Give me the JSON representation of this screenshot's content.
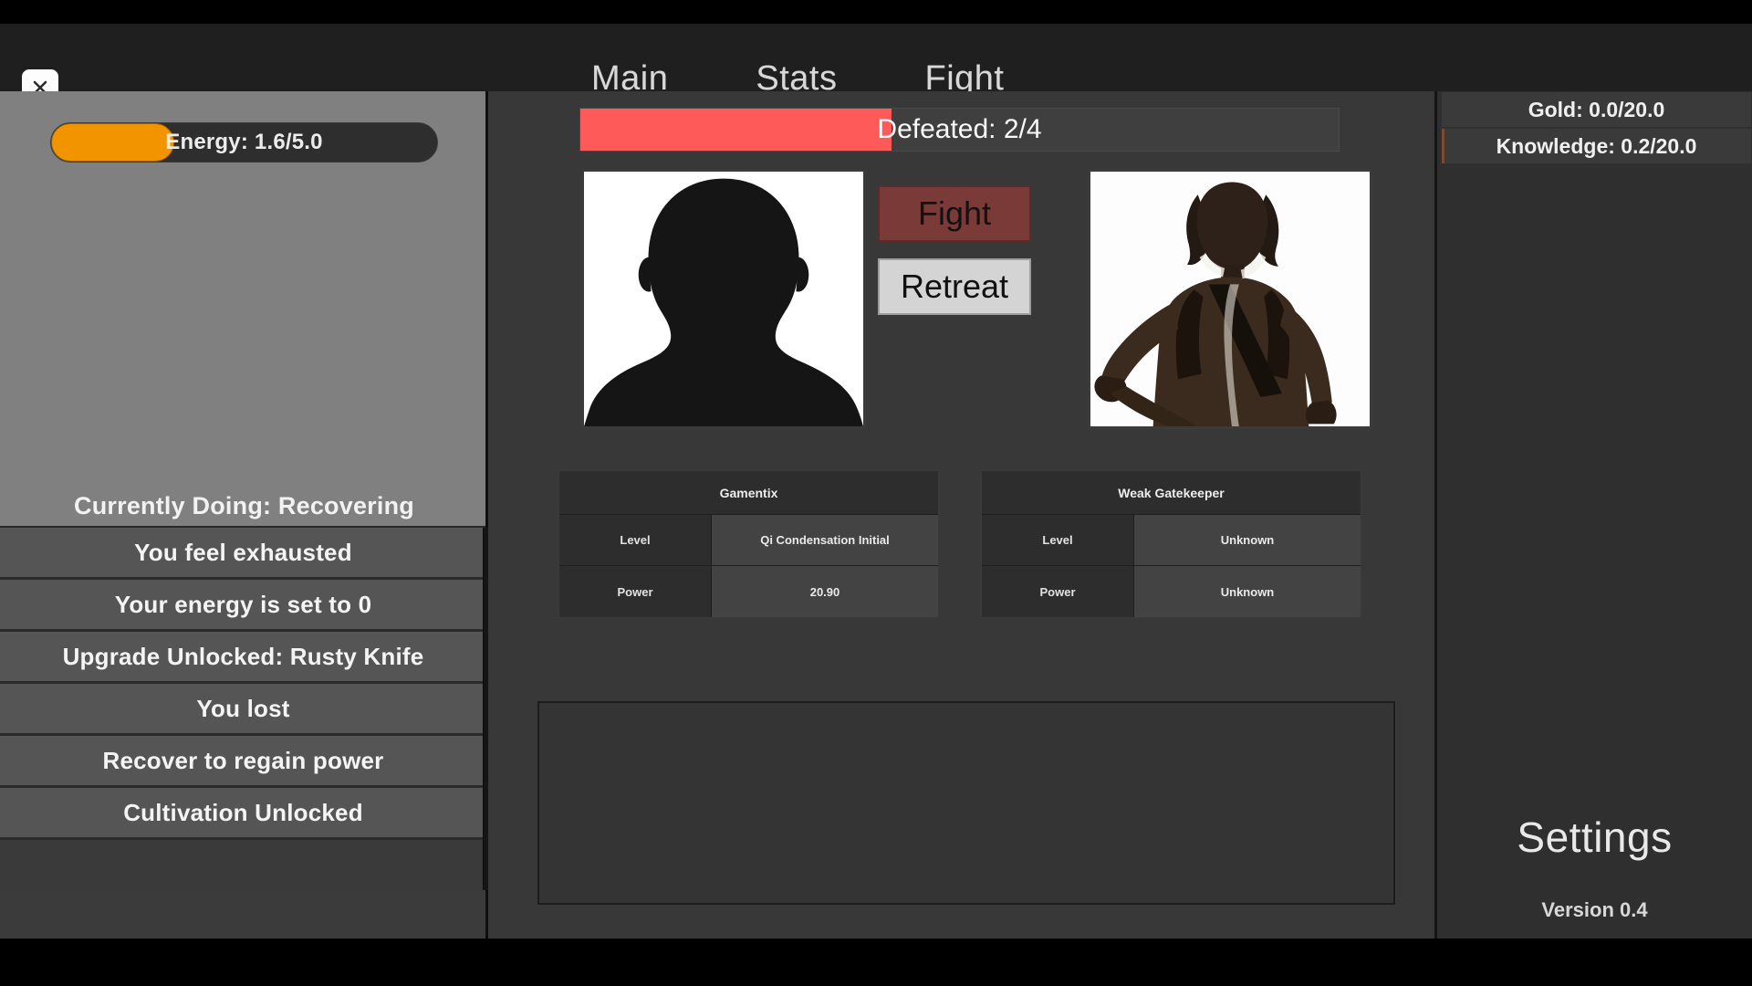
{
  "window": {
    "close_label": "×"
  },
  "nav": {
    "items": [
      {
        "label": "Main"
      },
      {
        "label": "Stats"
      },
      {
        "label": "Fight"
      }
    ]
  },
  "left_panel": {
    "energy": {
      "label": "Energy: 1.6/5.0",
      "current": 1.6,
      "max": 5.0,
      "percent": 32,
      "fill_color": "#f29400"
    },
    "current_activity": "Currently Doing: Recovering",
    "log": [
      {
        "text": "You feel exhausted"
      },
      {
        "text": "Your energy is set to 0"
      },
      {
        "text": "Upgrade Unlocked: Rusty Knife"
      },
      {
        "text": "You lost"
      },
      {
        "text": "Recover to regain power"
      },
      {
        "text": "Cultivation Unlocked"
      }
    ]
  },
  "center_panel": {
    "defeated": {
      "label": "Defeated: 2/4",
      "current": 2,
      "max": 4,
      "percent": 41,
      "fill_color": "#ff5a5a"
    },
    "actions": {
      "fight_label": "Fight",
      "retreat_label": "Retreat",
      "fight_color": "#7a3b38",
      "retreat_color": "#d4d4d4"
    },
    "player_stats": {
      "name": "Gamentix",
      "rows": [
        {
          "key": "Level",
          "value": "Qi Condensation Initial"
        },
        {
          "key": "Power",
          "value": "20.90"
        }
      ]
    },
    "enemy_stats": {
      "name": "Weak Gatekeeper",
      "rows": [
        {
          "key": "Level",
          "value": "Unknown"
        },
        {
          "key": "Power",
          "value": "Unknown"
        }
      ]
    }
  },
  "right_panel": {
    "resources": [
      {
        "label": "Gold: 0.0/20.0",
        "current": 0.0,
        "max": 20.0,
        "percent": 0
      },
      {
        "label": "Knowledge: 0.2/20.0",
        "current": 0.2,
        "max": 20.0,
        "percent": 1
      }
    ],
    "settings_label": "Settings",
    "version_label": "Version 0.4"
  }
}
